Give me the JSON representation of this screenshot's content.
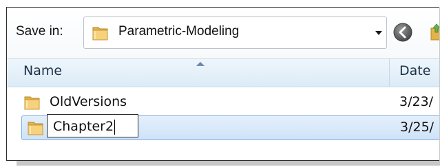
{
  "toolbar": {
    "save_in_label": "Save in:",
    "location_value": "Parametric-Modeling",
    "back_icon": "back-arrow-icon",
    "up_icon": "folder-up-icon"
  },
  "columns": {
    "name": "Name",
    "date": "Date"
  },
  "files": [
    {
      "name": "OldVersions",
      "date": "3/23/",
      "icon": "folder-icon",
      "selected": false
    },
    {
      "name": "Chapter2",
      "date": "3/25/",
      "icon": "folder-icon",
      "selected": true,
      "renaming": true
    }
  ],
  "colors": {
    "header_bg": "#dcebf7",
    "selection_bg": "#cfe3f8",
    "selection_border": "#84acdd",
    "folder_yellow": "#e8b84a"
  }
}
